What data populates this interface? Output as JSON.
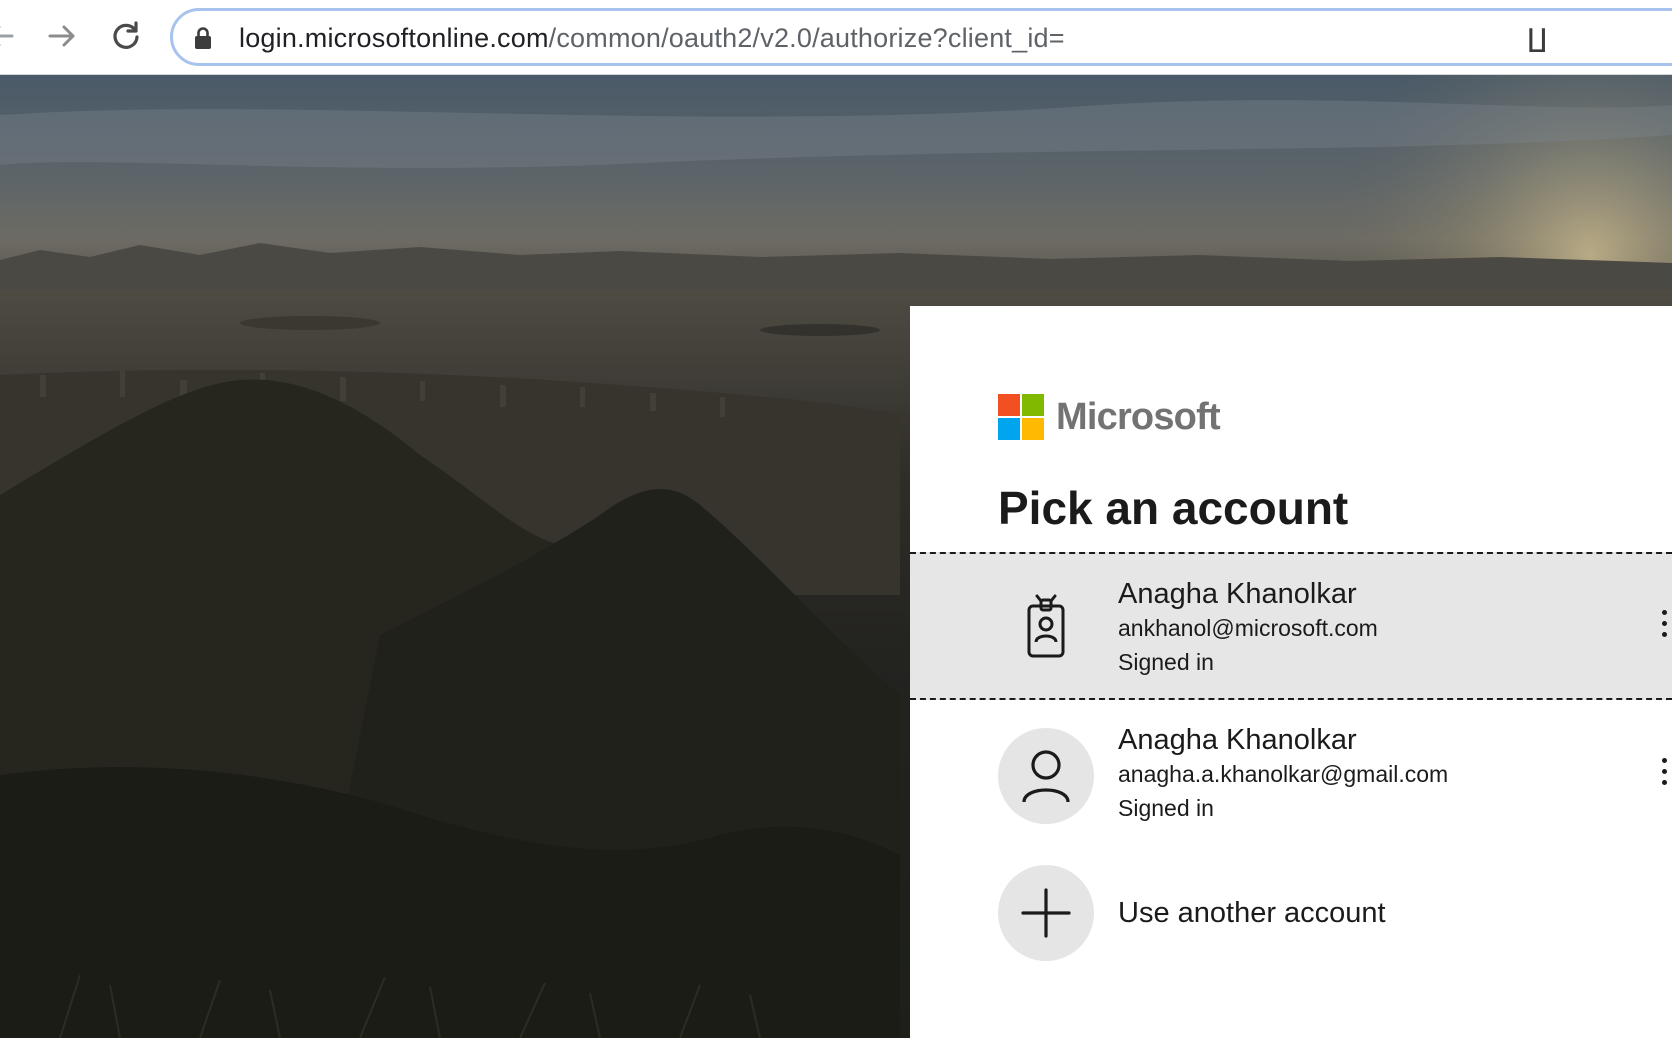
{
  "browser": {
    "url_host": "login.microsoftonline.com",
    "url_path": "/common/oauth2/v2.0/authorize?client_id=",
    "overflow_glyph": "∐",
    "icons": [
      "back-arrow-icon",
      "forward-arrow-icon",
      "reload-icon",
      "lock-icon"
    ]
  },
  "card": {
    "brand": "Microsoft",
    "brand_colors": [
      "#f25022",
      "#7fba00",
      "#00a4ef",
      "#ffb900"
    ],
    "title": "Pick an account",
    "accounts": [
      {
        "name": "Anagha Khanolkar",
        "email": "ankhanol@microsoft.com",
        "status": "Signed in",
        "icon": "work-badge-icon",
        "selected": true
      },
      {
        "name": "Anagha Khanolkar",
        "email": "anagha.a.khanolkar@gmail.com",
        "status": "Signed in",
        "icon": "person-icon",
        "selected": false
      }
    ],
    "add_account": {
      "label": "Use another account",
      "icon": "plus-icon"
    }
  }
}
